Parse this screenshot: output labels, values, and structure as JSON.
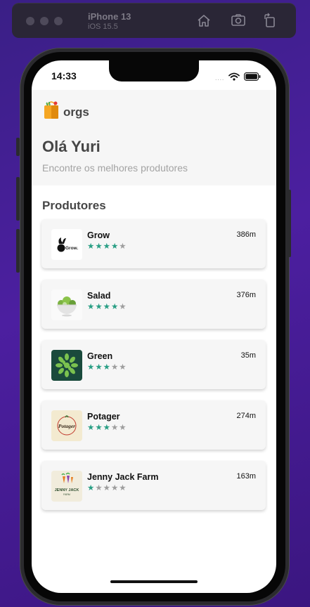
{
  "simulator": {
    "device": "iPhone 13",
    "os": "iOS 15.5",
    "icons": [
      "home-icon",
      "screenshot-icon",
      "rotate-icon"
    ]
  },
  "status_bar": {
    "time": "14:33",
    "dots": "....",
    "icons": [
      "wifi-icon",
      "battery-icon"
    ]
  },
  "app": {
    "logo_text": "orgs",
    "greeting": "Olá Yuri",
    "subtitle": "Encontre os melhores produtores",
    "section_title": "Produtores"
  },
  "producers": [
    {
      "name": "Grow",
      "distance": "386m",
      "rating": 4,
      "max": 5,
      "image": "grow-logo"
    },
    {
      "name": "Salad",
      "distance": "376m",
      "rating": 4,
      "max": 5,
      "image": "salad-bowl"
    },
    {
      "name": "Green",
      "distance": "35m",
      "rating": 3,
      "max": 5,
      "image": "green-leaves"
    },
    {
      "name": "Potager",
      "distance": "274m",
      "rating": 3,
      "max": 5,
      "image": "potager-logo"
    },
    {
      "name": "Jenny Jack Farm",
      "distance": "163m",
      "rating": 1,
      "max": 5,
      "image": "jenny-jack-logo"
    }
  ],
  "colors": {
    "star_on": "#2a9f85",
    "star_off": "#9e9e9e",
    "header_bg": "#f6f6f6",
    "text_dark": "#464646"
  }
}
